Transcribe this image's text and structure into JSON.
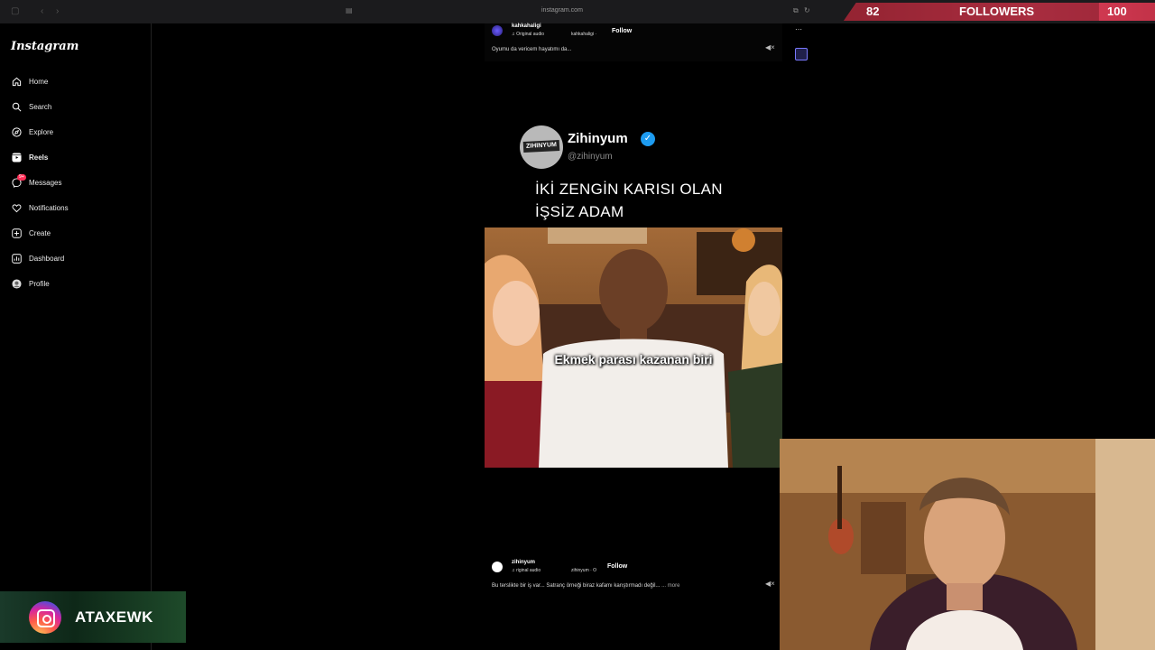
{
  "browser": {
    "url": "instagram.com"
  },
  "followers_overlay": {
    "current": "82",
    "label": "FOLLOWERS",
    "goal": "100",
    "progress_fraction": 0.82
  },
  "sidebar": {
    "logo": "Instagram",
    "items": [
      {
        "label": "Home",
        "icon": "home-icon"
      },
      {
        "label": "Search",
        "icon": "search-icon"
      },
      {
        "label": "Explore",
        "icon": "compass-icon"
      },
      {
        "label": "Reels",
        "icon": "reels-icon"
      },
      {
        "label": "Messages",
        "icon": "messenger-icon",
        "badge": "9+"
      },
      {
        "label": "Notifications",
        "icon": "heart-icon"
      },
      {
        "label": "Create",
        "icon": "plus-square-icon"
      },
      {
        "label": "Dashboard",
        "icon": "dashboard-icon"
      },
      {
        "label": "Profile",
        "icon": "profile-avatar-icon"
      }
    ]
  },
  "reel_top": {
    "username": "kahkahaligi",
    "audio": "Original audio",
    "audio_user": "kahkahaligi ·",
    "follow": "Follow",
    "caption": "Oyumu da vericem hayatımı da..."
  },
  "reel_main": {
    "tweet": {
      "avatar_text": "ZIHINYUM",
      "name": "Zihinyum",
      "handle": "@zihinyum",
      "text_line1": "İKİ ZENGİN KARISI OLAN",
      "text_line2": "İŞSİZ ADAM"
    },
    "video_caption": "Ekmek parası kazanan biri"
  },
  "reel_bottom": {
    "username": "zihinyum",
    "audio": "riginal audio",
    "audio_user": "zihinyum · O",
    "follow": "Follow",
    "caption": "Bu terslikte bir iş var... Satranç örneği biraz kafamı karıştırmadı değil...",
    "more": "... more"
  },
  "channel": {
    "name": "ATAXEWK"
  }
}
